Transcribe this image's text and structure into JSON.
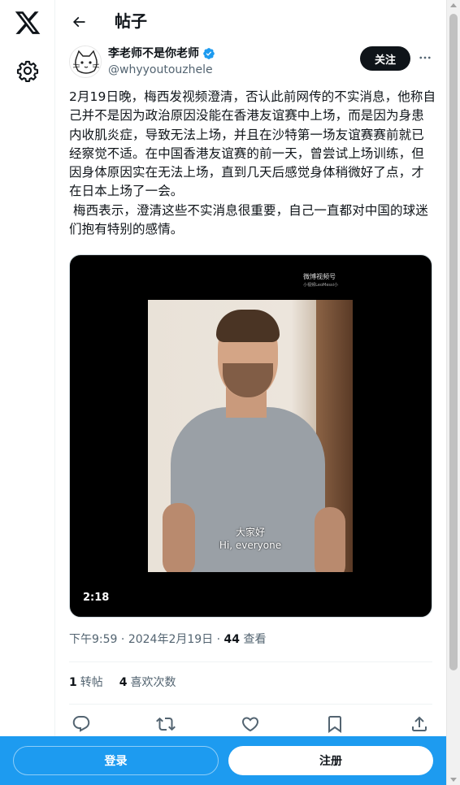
{
  "header": {
    "title": "帖子"
  },
  "author": {
    "display_name": "李老师不是你老师",
    "handle": "@whyyoutouzhele",
    "follow_label": "关注"
  },
  "tweet": {
    "text": "2月19日晚，梅西发视频澄清，否认此前网传的不实消息，他称自己并不是因为政治原因没能在香港友谊赛中上场，而是因为身患内收肌炎症，导致无法上场，并且在沙特第一场友谊赛赛前就已经察觉不适。在中国香港友谊赛的前一天，曾尝试上场训练，但因身体原因实在无法上场，直到几天后感觉身体稍微好了点，才在日本上场了一会。\n 梅西表示，澄清这些不实消息很重要，自己一直都对中国的球迷们抱有特别的感情。"
  },
  "video": {
    "watermark": "微博视频号",
    "watermark_sub": "小视频LeoMessi小",
    "subtitle_zh": "大家好",
    "subtitle_en": "Hi, everyone",
    "duration": "2:18"
  },
  "meta": {
    "time": "下午9:59",
    "date": "2024年2月19日",
    "views_count": "44",
    "views_label": "查看"
  },
  "stats": {
    "retweets_count": "1",
    "retweets_label": "转帖",
    "likes_count": "4",
    "likes_label": "喜欢次数"
  },
  "bottom_bar": {
    "login_label": "登录",
    "signup_label": "注册"
  },
  "colors": {
    "brand_blue": "#1d9bf0",
    "text_primary": "#0f1419",
    "text_secondary": "#536471"
  },
  "icons": [
    "x-logo-icon",
    "gear-icon",
    "back-arrow-icon",
    "verified-icon",
    "more-icon",
    "reply-icon",
    "retweet-icon",
    "like-icon",
    "bookmark-icon",
    "share-icon"
  ]
}
